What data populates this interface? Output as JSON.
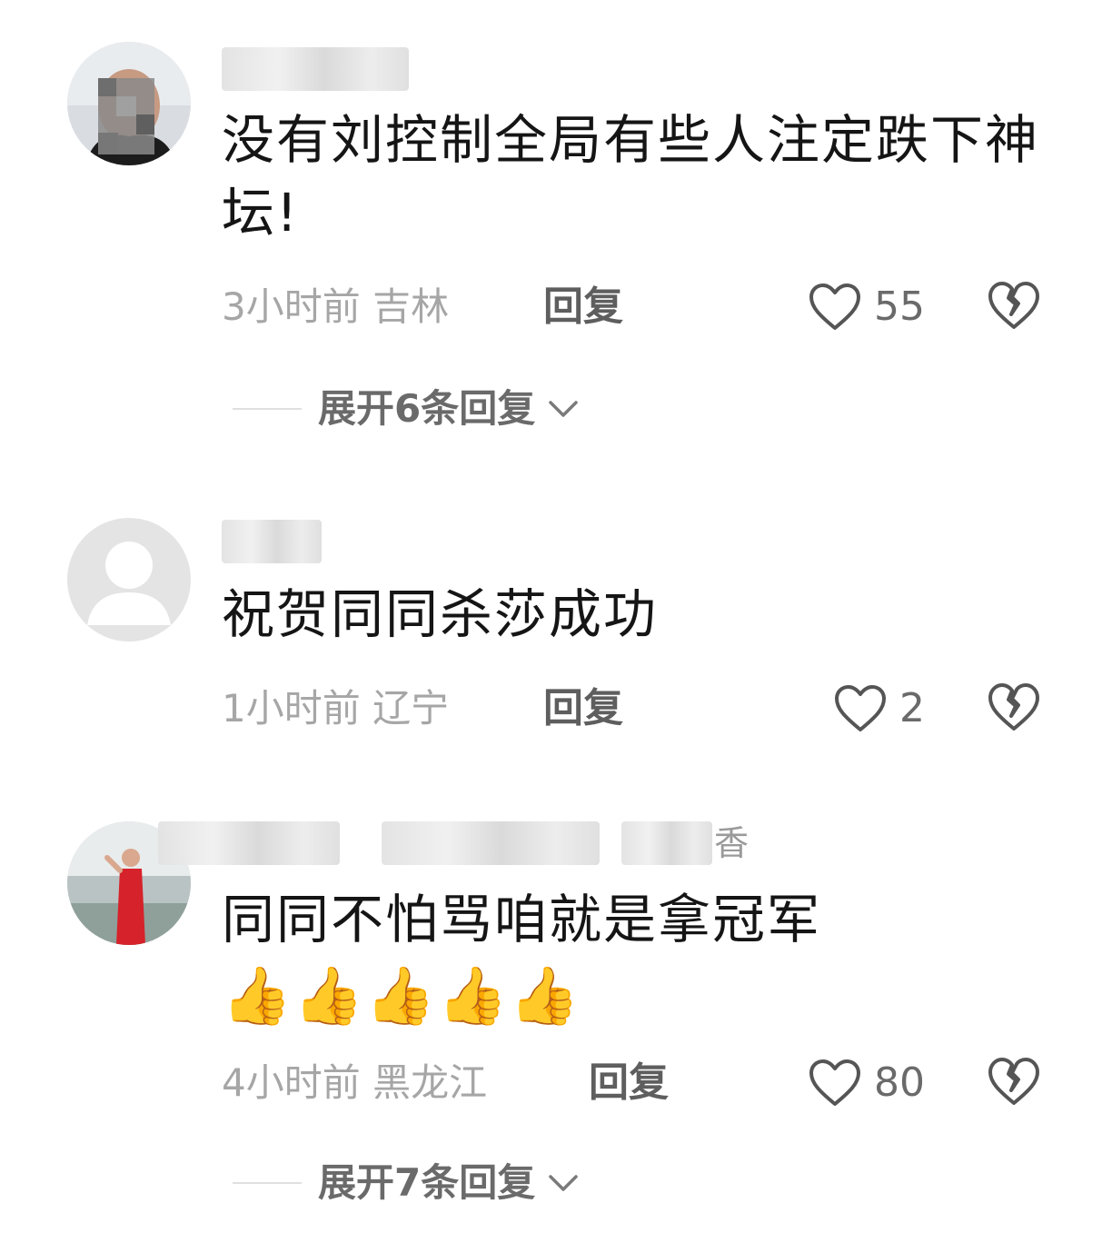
{
  "comments": [
    {
      "username_visible": "",
      "text": "没有刘控制全局有些人注定跌下神坛!",
      "time": "3小时前",
      "location": "吉林",
      "reply_label": "回复",
      "likes": "55",
      "expand_label": "展开6条回复"
    },
    {
      "username_visible": "",
      "text": "祝贺同同杀莎成功",
      "time": "1小时前",
      "location": "辽宁",
      "reply_label": "回复",
      "likes": "2",
      "expand_label": ""
    },
    {
      "username_visible": "香",
      "text": "同同不怕骂咱就是拿冠军",
      "emoji": "👍👍👍👍👍",
      "time": "4小时前",
      "location": "黑龙江",
      "reply_label": "回复",
      "likes": "80",
      "expand_label": "展开7条回复"
    }
  ],
  "icons": {
    "like": "heart-outline-icon",
    "dislike": "broken-heart-icon",
    "expand": "chevron-down-icon",
    "emoji": "thumbs-up-emoji"
  },
  "colors": {
    "text": "#151515",
    "meta": "#a6a6a6",
    "reply": "#5e5e5e"
  }
}
